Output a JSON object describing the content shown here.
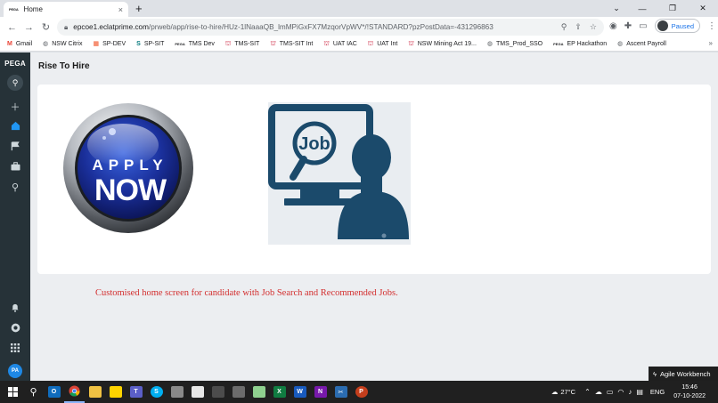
{
  "browser": {
    "tab": {
      "favicon": "PEGA",
      "title": "Home",
      "close": "×"
    },
    "new_tab": "+",
    "window_controls": {
      "chevron": "⌄",
      "minimize": "—",
      "maximize": "❐",
      "close": "✕"
    },
    "nav": {
      "back": "←",
      "forward": "→",
      "reload": "↻"
    },
    "url_domain": "epcoe1.eclatprime.com",
    "url_path": "/prweb/app/rise-to-hire/HUz-1lNaaaQB_lmMPiGxFX7MzqorVpWV*/!STANDARD?pzPostData=-431296863",
    "profile_label": "Paused",
    "bookmarks": [
      {
        "label": "Gmail",
        "icon": "M",
        "kind": "gmail"
      },
      {
        "label": "NSW Citrix",
        "icon": "◍",
        "kind": "globe"
      },
      {
        "label": "SP-DEV",
        "icon": "▦",
        "kind": "ms"
      },
      {
        "label": "SP-SIT",
        "icon": "S",
        "kind": "sp"
      },
      {
        "label": "TMS Dev",
        "icon": "PEGA",
        "kind": "pega"
      },
      {
        "label": "TMS-SIT",
        "icon": "⛫",
        "kind": "red"
      },
      {
        "label": "TMS-SIT Int",
        "icon": "⛫",
        "kind": "red"
      },
      {
        "label": "UAT IAC",
        "icon": "⛫",
        "kind": "red"
      },
      {
        "label": "UAT Int",
        "icon": "⛫",
        "kind": "red"
      },
      {
        "label": "NSW Mining Act 19...",
        "icon": "⛫",
        "kind": "red"
      },
      {
        "label": "TMS_Prod_SSO",
        "icon": "◍",
        "kind": "globe"
      },
      {
        "label": "EP Hackathon",
        "icon": "PEGA",
        "kind": "pega"
      },
      {
        "label": "Ascent Payroll",
        "icon": "◍",
        "kind": "globe"
      }
    ],
    "bookmarks_more": "»"
  },
  "pega": {
    "logo": "PEGA",
    "avatar": "PA",
    "page_title": "Rise To Hire",
    "apply_now": {
      "line1": "APPLY",
      "line2": "NOW"
    },
    "job_image_text": "Job",
    "caption": "Customised home screen for candidate with Job Search and Recommended Jobs."
  },
  "agile_workbench": "Agile Workbench",
  "taskbar": {
    "weather": "27°C",
    "language": "ENG",
    "time": "15:46",
    "date": "07-10-2022"
  },
  "colors": {
    "pega_nav": "#263238",
    "accent_blue": "#2196f3",
    "caption_red": "#d32f2f",
    "job_navy": "#1b4a6b"
  }
}
